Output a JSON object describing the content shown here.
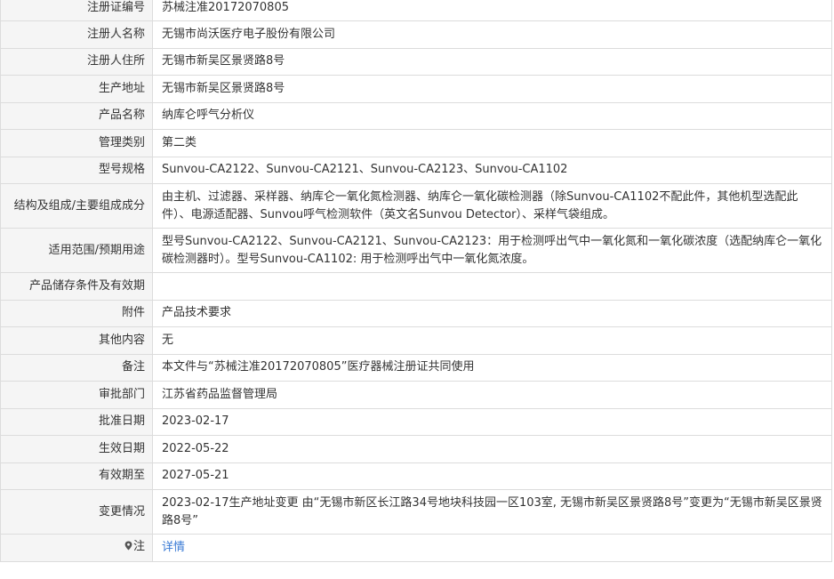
{
  "rows": [
    {
      "label": "注册证编号",
      "value": "苏械注准20172070805"
    },
    {
      "label": "注册人名称",
      "value": "无锡市尚沃医疗电子股份有限公司"
    },
    {
      "label": "注册人住所",
      "value": "无锡市新吴区景贤路8号"
    },
    {
      "label": "生产地址",
      "value": "无锡市新吴区景贤路8号"
    },
    {
      "label": "产品名称",
      "value": "纳库仑呼气分析仪"
    },
    {
      "label": "管理类别",
      "value": "第二类"
    },
    {
      "label": "型号规格",
      "value": "Sunvou-CA2122、Sunvou-CA2121、Sunvou-CA2123、Sunvou-CA1102"
    },
    {
      "label": "结构及组成/主要组成成分",
      "value": "由主机、过滤器、采样器、纳库仑一氧化氮检测器、纳库仑一氧化碳检测器（除Sunvou-CA1102不配此件，其他机型选配此件）、电源适配器、Sunvou呼气检测软件（英文名Sunvou Detector）、采样气袋组成。"
    },
    {
      "label": "适用范围/预期用途",
      "value": "型号Sunvou-CA2122、Sunvou-CA2121、Sunvou-CA2123：用于检测呼出气中一氧化氮和一氧化碳浓度（选配纳库仑一氧化碳检测器时）。型号Sunvou-CA1102: 用于检测呼出气中一氧化氮浓度。"
    },
    {
      "label": "产品储存条件及有效期",
      "value": ""
    },
    {
      "label": "附件",
      "value": "产品技术要求"
    },
    {
      "label": "其他内容",
      "value": "无"
    },
    {
      "label": "备注",
      "value": "本文件与“苏械注准20172070805”医疗器械注册证共同使用"
    },
    {
      "label": "审批部门",
      "value": "江苏省药品监督管理局"
    },
    {
      "label": "批准日期",
      "value": "2023-02-17"
    },
    {
      "label": "生效日期",
      "value": "2022-05-22"
    },
    {
      "label": "有效期至",
      "value": "2027-05-21"
    },
    {
      "label": "变更情况",
      "value": "2023-02-17生产地址变更 由“无锡市新区长江路34号地块科技园一区103室, 无锡市新吴区景贤路8号”变更为“无锡市新吴区景贤路8号”"
    }
  ],
  "note": {
    "label": "注",
    "link": "详情",
    "icon": "pin-icon"
  },
  "colors": {
    "label_bg": "#f5f5f5",
    "border": "#dcdcdc",
    "link": "#3a7bd5"
  }
}
